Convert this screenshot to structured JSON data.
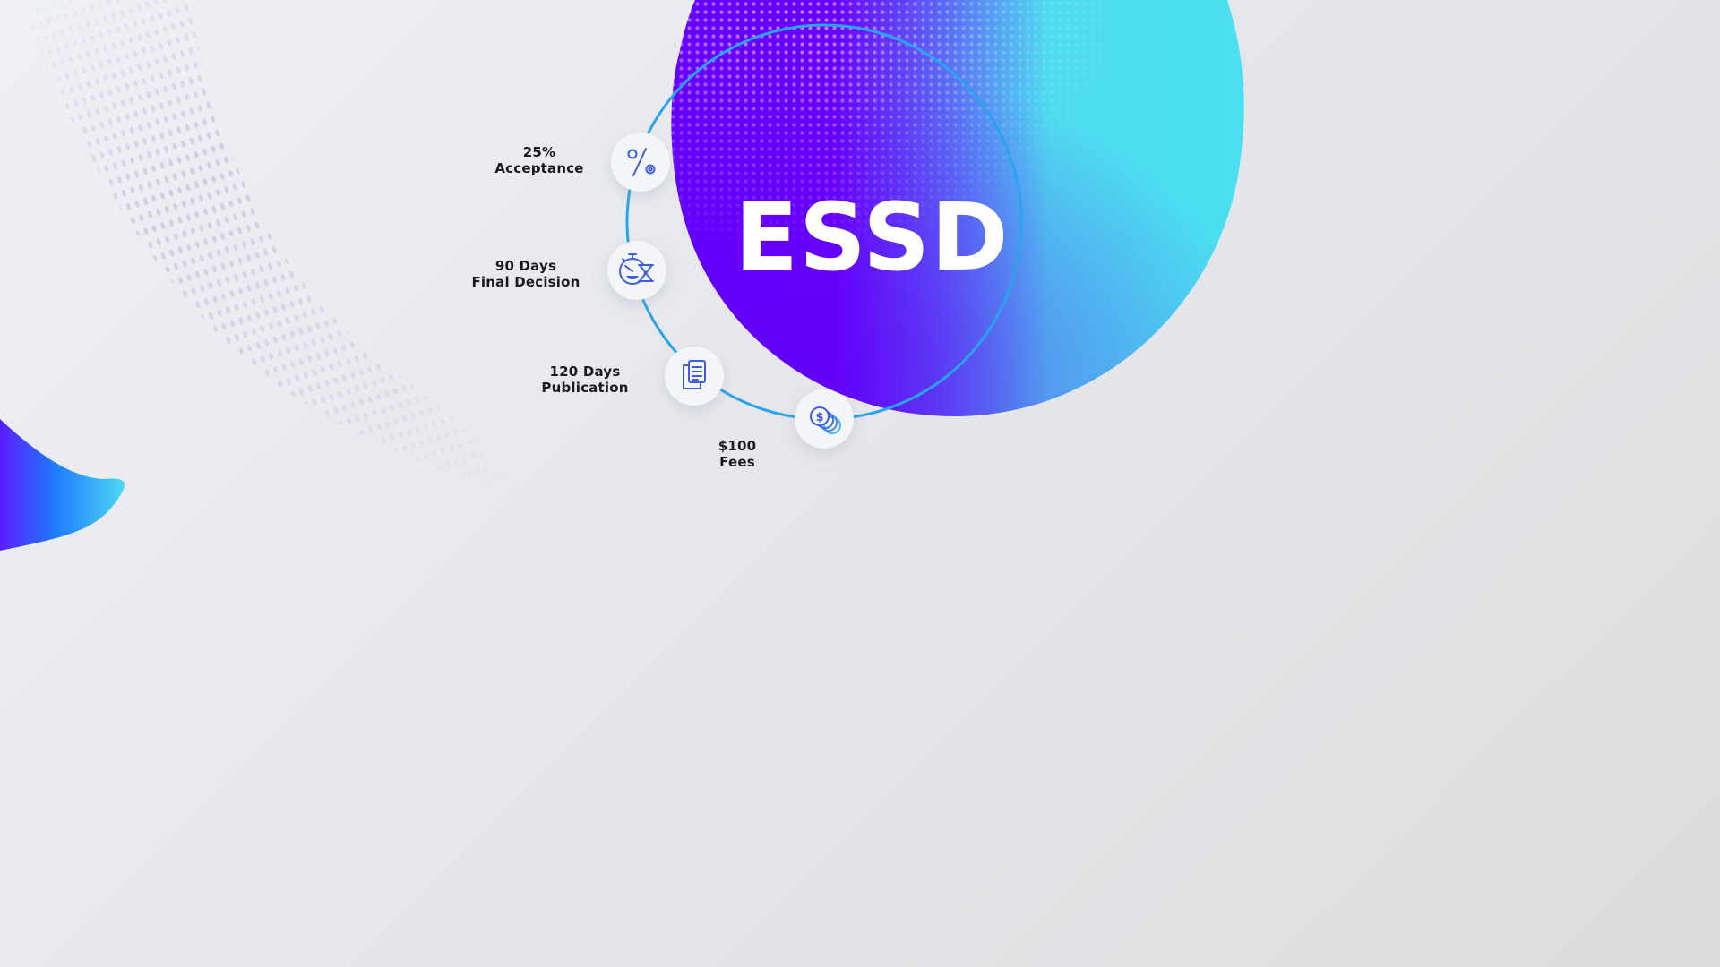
{
  "brand": {
    "title": "ESSD",
    "gradient_colors": [
      "#6a00ff",
      "#4fdcf0"
    ]
  },
  "stats": [
    {
      "value": "25%",
      "label": "Acceptance",
      "icon": "percent-icon"
    },
    {
      "value": "90 Days",
      "label": "Final Decision",
      "icon": "stopwatch-hourglass-icon"
    },
    {
      "value": "120 Days",
      "label": "Publication",
      "icon": "documents-icon"
    },
    {
      "value": "$100",
      "label": "Fees",
      "icon": "coins-icon"
    }
  ],
  "colors": {
    "ring": "#2aa4ea",
    "icon_stroke": "#3f5de0",
    "text": "#1b1b1f"
  }
}
